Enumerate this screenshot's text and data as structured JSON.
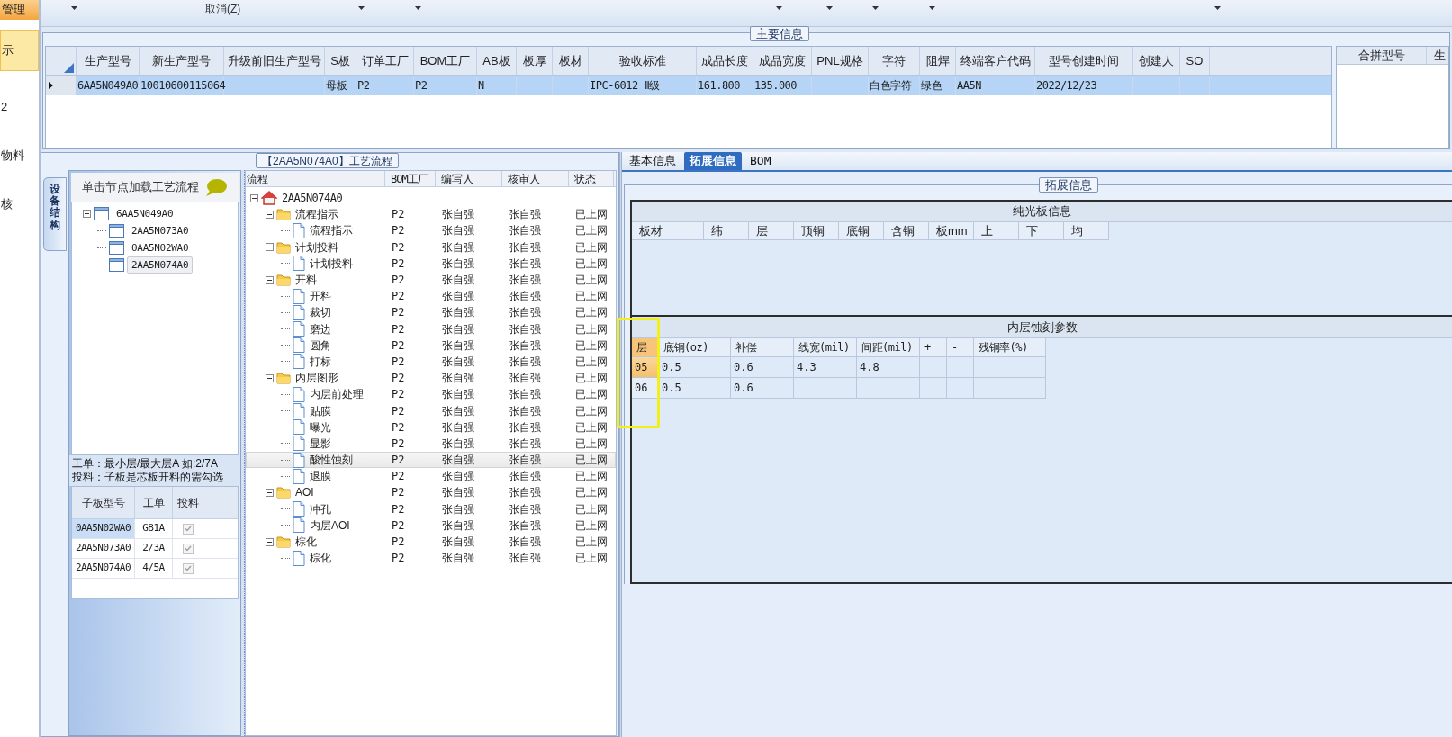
{
  "sidebar": {
    "header": "管理",
    "items": [
      {
        "label": "示",
        "selected": true
      },
      {
        "label": "2",
        "selected": false
      },
      {
        "label": "物料",
        "selected": false
      },
      {
        "label": "核",
        "selected": false
      }
    ]
  },
  "toolbar": [
    {
      "kind": "caret"
    },
    {
      "kind": "text",
      "label": "取消(Z)"
    },
    {
      "kind": "caret"
    },
    {
      "kind": "caret"
    },
    {
      "kind": "caret"
    },
    {
      "kind": "caret"
    },
    {
      "kind": "caret"
    },
    {
      "kind": "caret"
    },
    {
      "kind": "caret"
    }
  ],
  "main_info": {
    "title": "主要信息",
    "columns": [
      "生产型号",
      "新生产型号",
      "升级前旧生产型号",
      "S板",
      "订单工厂",
      "BOM工厂",
      "AB板",
      "板厚",
      "板材",
      "验收标准",
      "成品长度",
      "成品宽度",
      "PNL规格",
      "字符",
      "阻焊",
      "终端客户代码",
      "型号创建时间",
      "创建人",
      "SO"
    ],
    "rows": [
      {
        "selected": true,
        "cells": [
          "6AA5N049A0",
          "10010600115064",
          null,
          "母板",
          "P2",
          "P2",
          "N",
          null,
          null,
          "IPC-6012 Ⅱ级",
          "161.800",
          "135.000",
          null,
          "白色字符",
          "绿色",
          "AA5N",
          "2022/12/23",
          null,
          null
        ]
      }
    ],
    "merge_columns": [
      "合拼型号",
      "生"
    ]
  },
  "process": {
    "title": "【2AA5N074A0】工艺流程",
    "side_tab": "设备结构",
    "hint": "单击节点加载工艺流程",
    "device_tree": [
      {
        "label": "6AA5N049A0",
        "expanded": true,
        "selected": false,
        "children": [
          {
            "label": "2AA5N073A0",
            "selected": false
          },
          {
            "label": "0AA5N02WA0",
            "selected": false
          },
          {
            "label": "2AA5N074A0",
            "selected": true
          }
        ]
      }
    ],
    "notes": [
      "工单：最小层/最大层A 如:2/7A",
      "投料：子板是芯板开料的需勾选"
    ],
    "sub_boards": {
      "columns": [
        "子板型号",
        "工单",
        "投料"
      ],
      "rows": [
        {
          "cells": [
            "0AA5N02WA0",
            "GB1A"
          ],
          "checked": true,
          "selected": true
        },
        {
          "cells": [
            "2AA5N073A0",
            "2/3A"
          ],
          "checked": true,
          "selected": false
        },
        {
          "cells": [
            "2AA5N074A0",
            "4/5A"
          ],
          "checked": true,
          "selected": false
        }
      ]
    },
    "flow": {
      "columns": [
        "流程",
        "BOM工厂",
        "编写人",
        "核审人",
        "状态"
      ],
      "tree": [
        {
          "kind": "root",
          "label": "2AA5N074A0",
          "expanded": true,
          "selected": false,
          "children": [
            {
              "kind": "folder",
              "label": "流程指示",
              "expanded": true,
              "selected": false,
              "values": [
                "P2",
                "张自强",
                "张自强",
                "已上网"
              ],
              "children": [
                {
                  "kind": "step",
                  "label": "流程指示",
                  "selected": false,
                  "values": [
                    "P2",
                    "张自强",
                    "张自强",
                    "已上网"
                  ]
                }
              ]
            },
            {
              "kind": "folder",
              "label": "计划投料",
              "expanded": true,
              "selected": false,
              "values": [
                "P2",
                "张自强",
                "张自强",
                "已上网"
              ],
              "children": [
                {
                  "kind": "step",
                  "label": "计划投料",
                  "selected": false,
                  "values": [
                    "P2",
                    "张自强",
                    "张自强",
                    "已上网"
                  ]
                }
              ]
            },
            {
              "kind": "folder",
              "label": "开料",
              "expanded": true,
              "selected": false,
              "values": [
                "P2",
                "张自强",
                "张自强",
                "已上网"
              ],
              "children": [
                {
                  "kind": "step",
                  "label": "开料",
                  "selected": false,
                  "values": [
                    "P2",
                    "张自强",
                    "张自强",
                    "已上网"
                  ]
                },
                {
                  "kind": "step",
                  "label": "裁切",
                  "selected": false,
                  "values": [
                    "P2",
                    "张自强",
                    "张自强",
                    "已上网"
                  ]
                },
                {
                  "kind": "step",
                  "label": "磨边",
                  "selected": false,
                  "values": [
                    "P2",
                    "张自强",
                    "张自强",
                    "已上网"
                  ]
                },
                {
                  "kind": "step",
                  "label": "圆角",
                  "selected": false,
                  "values": [
                    "P2",
                    "张自强",
                    "张自强",
                    "已上网"
                  ]
                },
                {
                  "kind": "step",
                  "label": "打标",
                  "selected": false,
                  "values": [
                    "P2",
                    "张自强",
                    "张自强",
                    "已上网"
                  ]
                }
              ]
            },
            {
              "kind": "folder",
              "label": "内层图形",
              "expanded": true,
              "selected": false,
              "values": [
                "P2",
                "张自强",
                "张自强",
                "已上网"
              ],
              "children": [
                {
                  "kind": "step",
                  "label": "内层前处理",
                  "selected": false,
                  "values": [
                    "P2",
                    "张自强",
                    "张自强",
                    "已上网"
                  ]
                },
                {
                  "kind": "step",
                  "label": "贴膜",
                  "selected": false,
                  "values": [
                    "P2",
                    "张自强",
                    "张自强",
                    "已上网"
                  ]
                },
                {
                  "kind": "step",
                  "label": "曝光",
                  "selected": false,
                  "values": [
                    "P2",
                    "张自强",
                    "张自强",
                    "已上网"
                  ]
                },
                {
                  "kind": "step",
                  "label": "显影",
                  "selected": false,
                  "values": [
                    "P2",
                    "张自强",
                    "张自强",
                    "已上网"
                  ]
                },
                {
                  "kind": "step",
                  "label": "酸性蚀刻",
                  "selected": true,
                  "values": [
                    "P2",
                    "张自强",
                    "张自强",
                    "已上网"
                  ]
                },
                {
                  "kind": "step",
                  "label": "退膜",
                  "selected": false,
                  "values": [
                    "P2",
                    "张自强",
                    "张自强",
                    "已上网"
                  ]
                }
              ]
            },
            {
              "kind": "folder",
              "label": "AOI",
              "expanded": true,
              "selected": false,
              "values": [
                "P2",
                "张自强",
                "张自强",
                "已上网"
              ],
              "children": [
                {
                  "kind": "step",
                  "label": "冲孔",
                  "selected": false,
                  "values": [
                    "P2",
                    "张自强",
                    "张自强",
                    "已上网"
                  ]
                },
                {
                  "kind": "step",
                  "label": "内层AOI",
                  "selected": false,
                  "values": [
                    "P2",
                    "张自强",
                    "张自强",
                    "已上网"
                  ]
                }
              ]
            },
            {
              "kind": "folder",
              "label": "棕化",
              "expanded": true,
              "selected": false,
              "values": [
                "P2",
                "张自强",
                "张自强",
                "已上网"
              ],
              "children": [
                {
                  "kind": "step",
                  "label": "棕化",
                  "selected": false,
                  "values": [
                    "P2",
                    "张自强",
                    "张自强",
                    "已上网"
                  ]
                }
              ]
            }
          ]
        }
      ]
    }
  },
  "detail": {
    "tabs": [
      {
        "label": "基本信息",
        "selected": false
      },
      {
        "label": "拓展信息",
        "selected": true
      },
      {
        "label": "BOM",
        "selected": false
      }
    ],
    "group_title": "拓展信息",
    "bare_board": {
      "title": "纯光板信息",
      "columns": [
        "板材",
        "纬",
        "层",
        "顶铜",
        "底铜",
        "含铜",
        "板mm",
        "上",
        "下",
        "均"
      ]
    },
    "etch": {
      "title": "内层蚀刻参数",
      "highlight_frame": true,
      "columns": [
        "层",
        "底铜(oz)",
        "补偿",
        "线宽(mil)",
        "间距(mil)",
        "+",
        "-",
        "残铜率(%)"
      ],
      "rows": [
        {
          "selected": true,
          "cells": [
            "05",
            "0.5",
            "0.6",
            "4.3",
            "4.8",
            null,
            null,
            null
          ]
        },
        {
          "selected": false,
          "cells": [
            "06",
            "0.5",
            "0.6",
            null,
            null,
            null,
            null,
            null
          ]
        }
      ]
    }
  }
}
